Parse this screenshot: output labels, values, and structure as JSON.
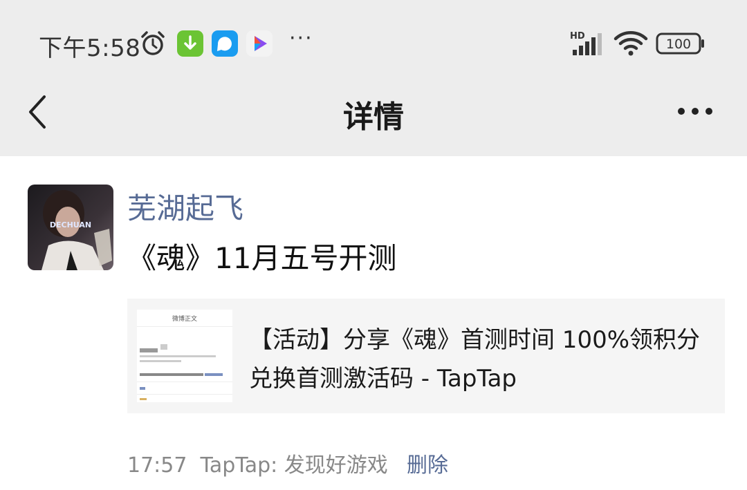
{
  "status_bar": {
    "time": "下午5:58",
    "more": "···",
    "network": "HD",
    "battery": "100",
    "icons": [
      "alarm-icon",
      "download-app-icon",
      "chat-app-icon",
      "video-play-icon",
      "signal-icon",
      "wifi-icon",
      "battery-icon"
    ]
  },
  "nav": {
    "title": "详情",
    "back_icon": "chevron-left-icon",
    "more_icon": "more-dots-icon"
  },
  "post": {
    "username": "芜湖起飞",
    "avatar_text": "DECHUAN",
    "text": "《魂》11月五号开测",
    "link": {
      "title": "【活动】分享《魂》首测时间 100%领积分兑换首测激活码 - TapTap",
      "thumb_header": "微博正文"
    },
    "time": "17:57",
    "source": "TapTap: 发现好游戏",
    "delete_label": "删除"
  },
  "colors": {
    "header_bg": "#ededed",
    "link_blue": "#576b95",
    "card_bg": "#f5f5f5"
  }
}
